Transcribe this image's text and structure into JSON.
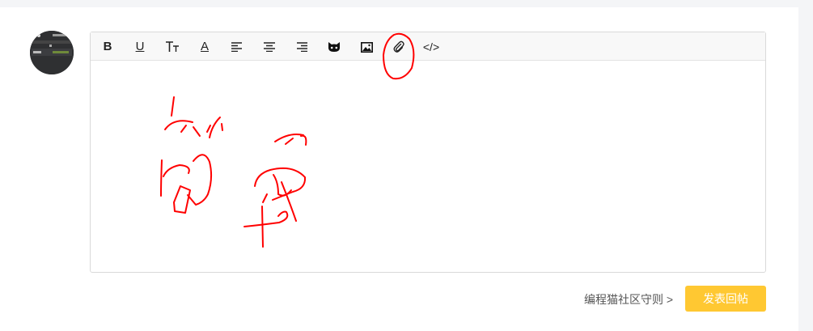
{
  "toolbar": {
    "items": [
      {
        "name": "bold",
        "label": "B"
      },
      {
        "name": "underline",
        "label": "U"
      },
      {
        "name": "font-size",
        "label": "T"
      },
      {
        "name": "font-color",
        "label": "A"
      },
      {
        "name": "align-left"
      },
      {
        "name": "align-center"
      },
      {
        "name": "align-right"
      },
      {
        "name": "emoji",
        "icon": "cat-icon"
      },
      {
        "name": "image",
        "icon": "image-icon"
      },
      {
        "name": "attachment",
        "icon": "paperclip-icon"
      },
      {
        "name": "code",
        "label": "</>"
      }
    ]
  },
  "footer": {
    "guidelines_label": "编程猫社区守则 >",
    "submit_label": "发表回帖"
  },
  "colors": {
    "accent": "#ffc832",
    "annotation": "#ff0000"
  }
}
